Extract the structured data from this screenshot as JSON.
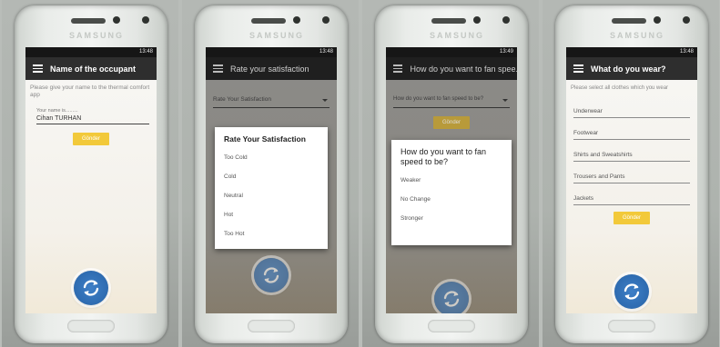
{
  "status_bar": [
    "13:48",
    "13:48",
    "13:49",
    "13:48"
  ],
  "brand": "SAMSUNG",
  "screen1": {
    "title": "Name of the occupant",
    "hint": "Please give your name to the thermal comfort app",
    "field_label": "Your name is.........",
    "field_value": "Cihan TURHAN",
    "button": "Gönder"
  },
  "screen2": {
    "title": "Rate your satisfaction",
    "dropdown_value": "Rate Your Satisfaction",
    "dialog_title": "Rate Your Satisfaction",
    "options": [
      "Too Cold",
      "Cold",
      "Neutral",
      "Hot",
      "Too Hot"
    ]
  },
  "screen3": {
    "title": "How do you want to fan spee...",
    "dropdown_value": "How do you want to fan speed to be?",
    "button": "Gönder",
    "dialog_title": "How do you want to fan speed to be?",
    "options": [
      "Weaker",
      "No Change",
      "Stronger"
    ]
  },
  "screen4": {
    "title": "What do you wear?",
    "hint": "Please select all clothes which you wear",
    "items": [
      "Underwear",
      "Footwear",
      "Shirts and Sweatshirts",
      "Trousers and Pants",
      "Jackets"
    ],
    "button": "Gönder"
  },
  "icons": {
    "menu": "hamburger-menu-icon",
    "refresh": "refresh-icon",
    "dropdown": "chevron-down-icon"
  },
  "colors": {
    "appbar": "#2e2e2e",
    "button": "#f2c93a",
    "fab": "#2e6bb0"
  }
}
